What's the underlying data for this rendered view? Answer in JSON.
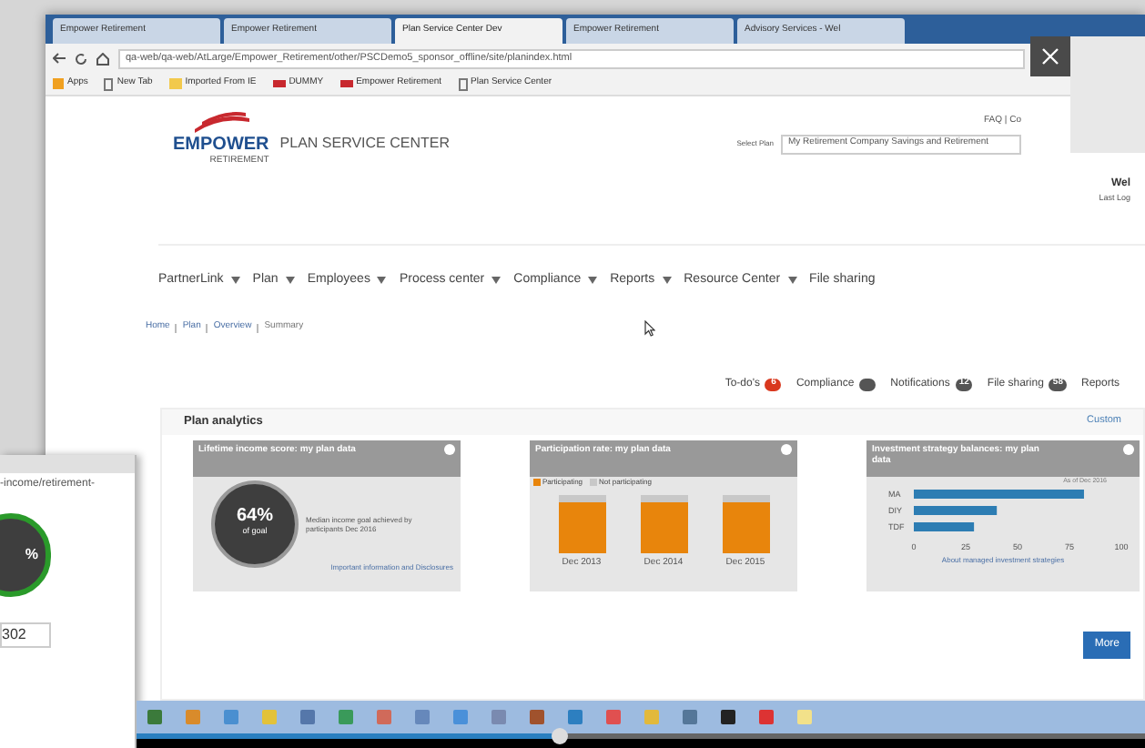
{
  "browser": {
    "tabs": [
      {
        "title": "Empower Retirement",
        "selected": false
      },
      {
        "title": "Empower Retirement",
        "selected": false
      },
      {
        "title": "Plan Service Center Dev",
        "selected": true
      },
      {
        "title": "Empower Retirement",
        "selected": false
      },
      {
        "title": "Advisory Services - Wel",
        "selected": false
      }
    ],
    "url": "qa-web/qa-web/AtLarge/Empower_Retirement/other/PSCDemo5_sponsor_offline/site/planindex.html",
    "bookmarks": [
      {
        "label": "Apps",
        "kind": "apps"
      },
      {
        "label": "New Tab",
        "kind": "page"
      },
      {
        "label": "Imported From IE",
        "kind": "folder"
      },
      {
        "label": "DUMMY",
        "kind": "site"
      },
      {
        "label": "Empower Retirement",
        "kind": "site"
      },
      {
        "label": "Plan Service Center",
        "kind": "page"
      }
    ]
  },
  "header": {
    "brand": "EMPOWER",
    "brand_sub": "RETIREMENT",
    "product": "PLAN SERVICE CENTER",
    "top_links": "FAQ | Co",
    "select_label": "Select Plan",
    "select_value": "My Retirement Company Savings and Retirement",
    "welcome": "Wel",
    "last_login": "Last Log"
  },
  "nav": [
    {
      "label": "PartnerLink",
      "dropdown": true
    },
    {
      "label": "Plan",
      "dropdown": true
    },
    {
      "label": "Employees",
      "dropdown": true
    },
    {
      "label": "Process center",
      "dropdown": true
    },
    {
      "label": "Compliance",
      "dropdown": true
    },
    {
      "label": "Reports",
      "dropdown": true
    },
    {
      "label": "Resource Center",
      "dropdown": true
    },
    {
      "label": "File sharing",
      "dropdown": false
    }
  ],
  "breadcrumb": [
    "Home",
    "Plan",
    "Overview",
    "Summary"
  ],
  "quick_tabs": [
    {
      "label": "To-do's",
      "count": "6",
      "color": "#d9381e"
    },
    {
      "label": "Compliance",
      "color": "#555555"
    },
    {
      "label": "Notifications",
      "count": "12",
      "color": "#555555"
    },
    {
      "label": "File sharing",
      "count": "58",
      "color": "#555555"
    },
    {
      "label": "Reports"
    }
  ],
  "analytics": {
    "title": "Plan analytics",
    "customize": "Custom",
    "income_card": {
      "title": "Lifetime income score: my plan data",
      "percent": "64%",
      "percent_label": "of goal",
      "description": "Median income goal achieved by participants Dec 2016",
      "link": "Important information and Disclosures"
    },
    "participation_card": {
      "title": "Participation rate: my plan data",
      "legend": [
        {
          "label": "Participating",
          "color": "#e8850c"
        },
        {
          "label": "Not participating",
          "color": "#c8c8c8"
        }
      ],
      "years": [
        "Dec 2013",
        "Dec 2014",
        "Dec 2015"
      ]
    },
    "strategy_card": {
      "title": "Investment strategy balances: my plan data",
      "as_of": "As of Dec 2016",
      "link": "About managed investment strategies",
      "chart_data": {
        "type": "bar",
        "orientation": "horizontal",
        "categories": [
          "MA",
          "DIY",
          "TDF"
        ],
        "values": [
          82,
          40,
          29
        ],
        "xlim": [
          0,
          100
        ],
        "xticks": [
          0,
          25,
          50,
          75,
          100
        ]
      }
    },
    "more": "More"
  },
  "overlay": {
    "url": "-income/retirement-",
    "gauge": "%",
    "field": "302"
  },
  "player": {
    "level": 0.42
  }
}
